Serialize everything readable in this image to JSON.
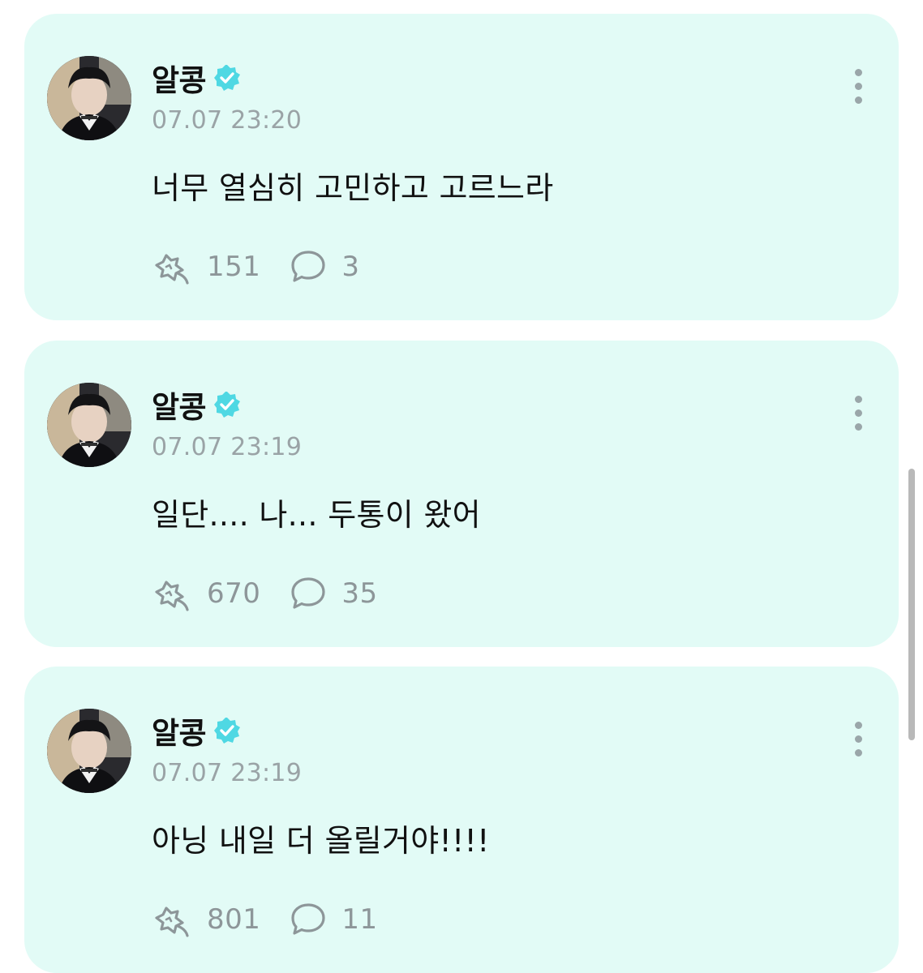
{
  "posts": [
    {
      "author": "알콩",
      "time": "07.07 23:20",
      "text": "너무 열심히 고민하고 고르느라",
      "reactions": "151",
      "comments": "3"
    },
    {
      "author": "알콩",
      "time": "07.07 23:19",
      "text": "일단.... 나... 두통이 왔어",
      "reactions": "670",
      "comments": "35"
    },
    {
      "author": "알콩",
      "time": "07.07 23:19",
      "text": "아닝 내일 더 올릴거야!!!!",
      "reactions": "801",
      "comments": "11"
    }
  ],
  "icons": {
    "verified": "verified-badge-icon",
    "more": "more-vertical-icon",
    "reaction": "reaction-icon",
    "comment": "comment-bubble-icon"
  },
  "colors": {
    "card_background": "#e2fbf6",
    "verified_badge": "#4fd8e3",
    "muted_text": "#9aa3a6"
  }
}
